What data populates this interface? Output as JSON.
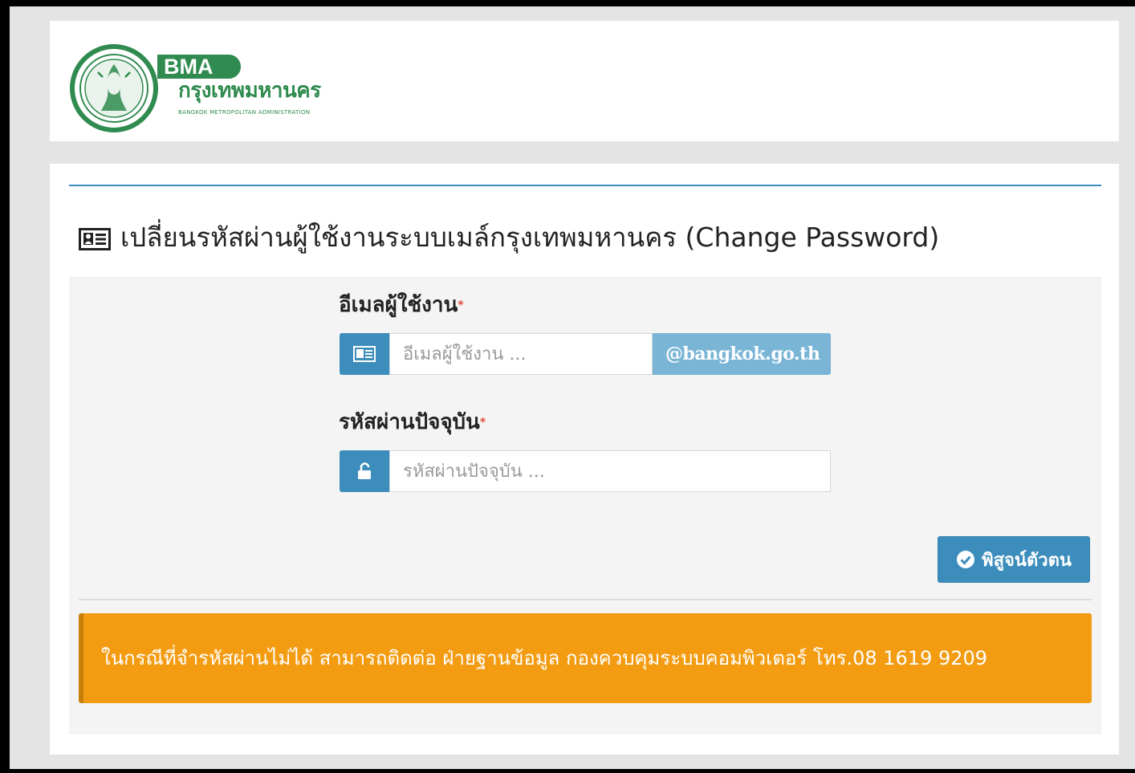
{
  "header": {
    "logo_abbrev": "BMA",
    "logo_thai": "กรุงเทพมหานคร",
    "logo_sub": "BANGKOK METROPOLITAN ADMINISTRATION"
  },
  "panel": {
    "title": "เปลี่ยนรหัสผ่านผู้ใช้งานระบบเมล์กรุงเทพมหานคร (Change Password)",
    "title_icon": "id-card-icon"
  },
  "form": {
    "email": {
      "label": "อีเมลผู้ใช้งาน",
      "placeholder": "อีเมลผู้ใช้งาน ...",
      "value": "",
      "suffix": "@bangkok.go.th",
      "icon": "id-card-icon"
    },
    "password": {
      "label": "รหัสผ่านปัจจุบัน",
      "placeholder": "รหัสผ่านปัจจุบัน ...",
      "value": "",
      "icon": "unlock-icon"
    },
    "required_mark": "*"
  },
  "actions": {
    "verify_label": "พิสูจน์ตัวตน",
    "verify_icon": "check-circle-icon"
  },
  "alert": {
    "text": "ในกรณีที่จำรหัสผ่านไม่ได้ สามารถติดต่อ ฝ่ายฐานข้อมูล กองควบคุมระบบคอมพิวเตอร์ โทร.08 1619 9209"
  },
  "colors": {
    "primary": "#3c8dbc",
    "addon_light": "#7ab5d6",
    "warning": "#f39c12",
    "brand_green": "#2f8b4f"
  }
}
